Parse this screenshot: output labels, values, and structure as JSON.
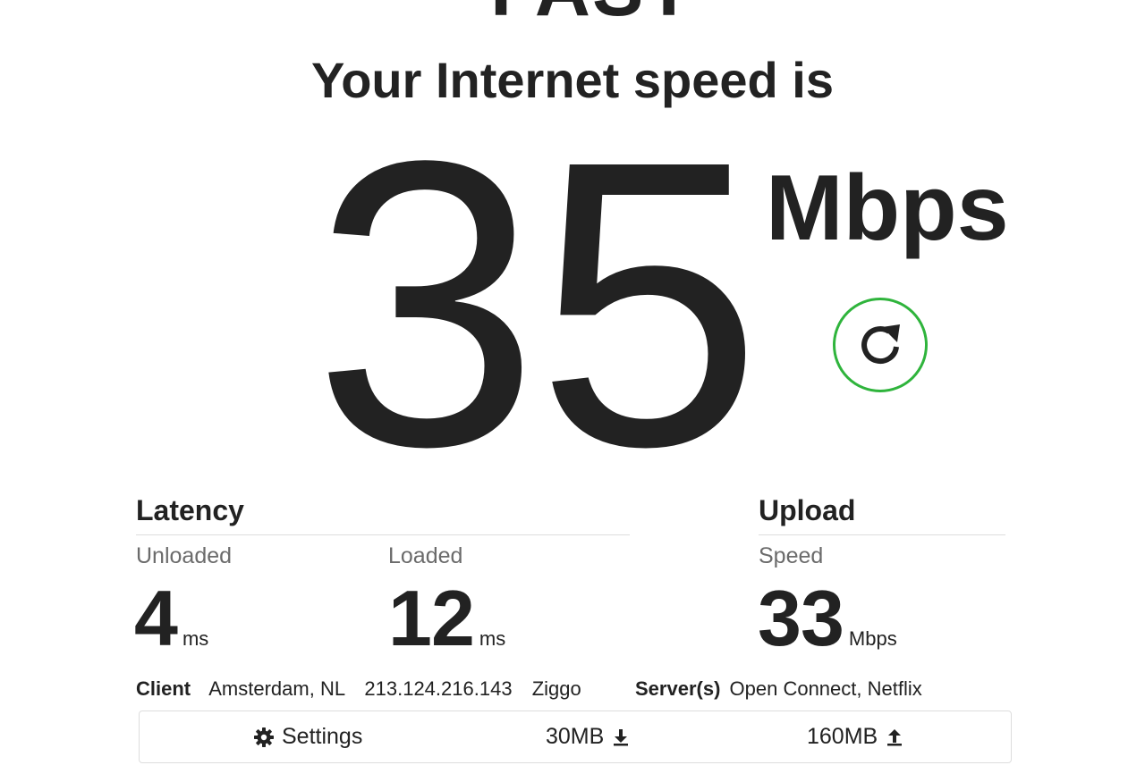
{
  "logo": {
    "text": "FAST"
  },
  "headline": "Your Internet speed is",
  "speed": {
    "value": "35",
    "unit": "Mbps"
  },
  "refresh": {
    "icon": "refresh-icon",
    "accent_color": "#2fb43c"
  },
  "latency": {
    "title": "Latency",
    "unloaded": {
      "label": "Unloaded",
      "value": "4",
      "unit": "ms"
    },
    "loaded": {
      "label": "Loaded",
      "value": "12",
      "unit": "ms"
    }
  },
  "upload": {
    "title": "Upload",
    "speed": {
      "label": "Speed",
      "value": "33",
      "unit": "Mbps"
    }
  },
  "client": {
    "label": "Client",
    "location": "Amsterdam, NL",
    "ip": "213.124.216.143",
    "isp": "Ziggo"
  },
  "servers": {
    "label": "Server(s)",
    "value": "Open Connect, Netflix"
  },
  "settings_bar": {
    "settings_label": "Settings",
    "download_size": "30MB",
    "upload_size": "160MB"
  }
}
